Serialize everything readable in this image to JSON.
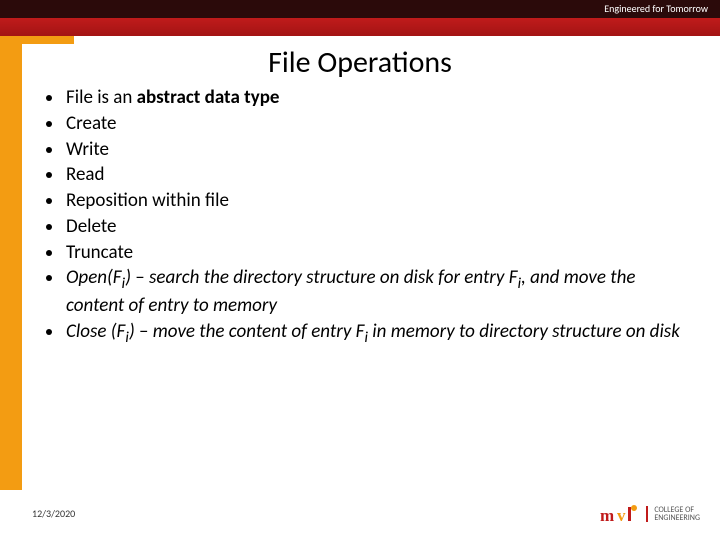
{
  "header": {
    "tagline": "Engineered for Tomorrow"
  },
  "title": "File Operations",
  "bullets": {
    "b0_pre": "File is an ",
    "b0_bold": "abstract data type",
    "b1": "Create",
    "b2": "Write",
    "b3": "Read",
    "b4": "Reposition within file",
    "b5": "Delete",
    "b6": "Truncate",
    "b7_a": "Open(F",
    "b7_b": "i",
    "b7_c": ") ",
    "b7_dash": "–",
    "b7_d": " search the directory structure on disk for entry F",
    "b7_e": "i",
    "b7_f": ", and move the content of entry to memory",
    "b8_a": "Close (F",
    "b8_b": "i",
    "b8_c": ") ",
    "b8_dash": "–",
    "b8_d": " move the content of entry F",
    "b8_e": "i",
    "b8_f": " in memory to directory structure on disk"
  },
  "footer": {
    "date": "12/3/2020",
    "logo_line1": "COLLEGE OF",
    "logo_line2": "ENGINEERING"
  },
  "colors": {
    "dark": "#2b0a0a",
    "red": "#c01b1b",
    "orange": "#f39c12"
  }
}
